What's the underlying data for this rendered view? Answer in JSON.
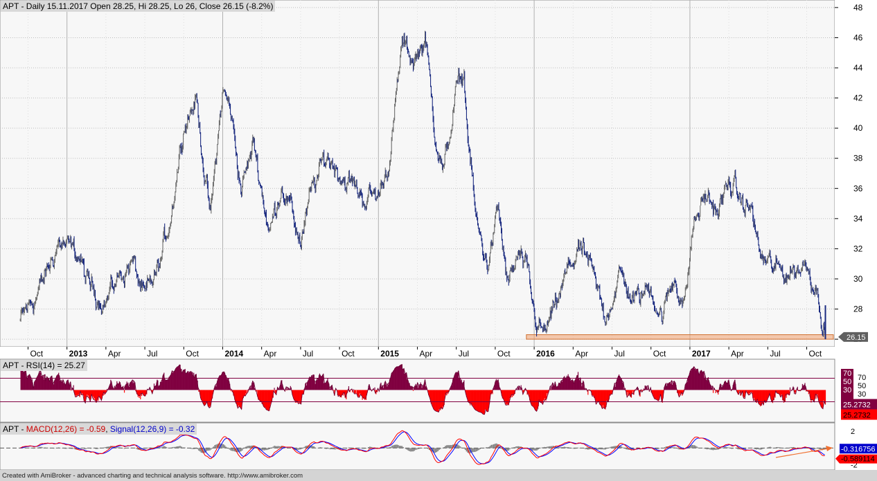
{
  "price_panel": {
    "title": "APT - Daily 15.11.2017 Open 28.25, Hi 28.25, Lo 26, Close 26.15 (-8.2%)",
    "last_close_label": "26.15",
    "highlight_color": "#f0a070"
  },
  "rsi_panel": {
    "title": "APT - RSI(14) = 25.27",
    "value_label": "25.2732",
    "levels": [
      "70",
      "50",
      "30"
    ]
  },
  "macd_panel": {
    "prefix": "APT - ",
    "macd_label": "MACD(12,26) = -0.59",
    "signal_label": "Signal(12,26,9) = -0.32",
    "signal_value_label": "-0.316756",
    "macd_value_label": "-0.589114",
    "ticks": [
      "2",
      "-2"
    ]
  },
  "footer": "Created with AmiBroker - advanced charting and technical analysis software. http://www.amibroker.com",
  "chart_data": [
    {
      "type": "line",
      "title": "APT - Daily 15.11.2017 Open 28.25, Hi 28.25, Lo 26, Close 26.15 (-8.2%)",
      "y_ticks": [
        26,
        28,
        30,
        32,
        34,
        36,
        38,
        40,
        42,
        44,
        46,
        48
      ],
      "ylim": [
        25.5,
        48.5
      ],
      "x_labels": [
        "Oct",
        "2013",
        "Apr",
        "Jul",
        "Oct",
        "2014",
        "Apr",
        "Jul",
        "Oct",
        "2015",
        "Apr",
        "Jul",
        "Oct",
        "2016",
        "Apr",
        "Jul",
        "Oct",
        "2017",
        "Apr",
        "Jul",
        "Oct"
      ],
      "close_anchors": [
        [
          2012.7,
          27.2
        ],
        [
          2012.78,
          28.5
        ],
        [
          2012.87,
          30.3
        ],
        [
          2012.95,
          32.6
        ],
        [
          2013.0,
          32.0
        ],
        [
          2013.08,
          31.5
        ],
        [
          2013.13,
          29.6
        ],
        [
          2013.25,
          28.6
        ],
        [
          2013.33,
          30.1
        ],
        [
          2013.42,
          31.2
        ],
        [
          2013.5,
          28.5
        ],
        [
          2013.6,
          31.0
        ],
        [
          2013.67,
          34.5
        ],
        [
          2013.75,
          40.5
        ],
        [
          2013.83,
          41.9
        ],
        [
          2013.92,
          34.0
        ],
        [
          2014.0,
          42.5
        ],
        [
          2014.05,
          41.2
        ],
        [
          2014.12,
          36.0
        ],
        [
          2014.2,
          39.0
        ],
        [
          2014.3,
          33.0
        ],
        [
          2014.38,
          36.5
        ],
        [
          2014.5,
          32.5
        ],
        [
          2014.58,
          36.0
        ],
        [
          2014.67,
          38.2
        ],
        [
          2014.8,
          36.5
        ],
        [
          2014.9,
          35.5
        ],
        [
          2015.0,
          35.5
        ],
        [
          2015.08,
          38.5
        ],
        [
          2015.15,
          45.5
        ],
        [
          2015.23,
          44.5
        ],
        [
          2015.3,
          46.0
        ],
        [
          2015.36,
          40.0
        ],
        [
          2015.42,
          37.0
        ],
        [
          2015.5,
          42.5
        ],
        [
          2015.55,
          43.5
        ],
        [
          2015.57,
          40.0
        ],
        [
          2015.63,
          33.5
        ],
        [
          2015.7,
          31.0
        ],
        [
          2015.77,
          34.5
        ],
        [
          2015.83,
          29.5
        ],
        [
          2015.9,
          31.5
        ],
        [
          2015.96,
          30.0
        ],
        [
          2016.0,
          27.5
        ],
        [
          2016.06,
          26.3
        ],
        [
          2016.12,
          27.5
        ],
        [
          2016.2,
          30.0
        ],
        [
          2016.28,
          32.0
        ],
        [
          2016.35,
          31.0
        ],
        [
          2016.45,
          27.5
        ],
        [
          2016.55,
          30.2
        ],
        [
          2016.65,
          28.5
        ],
        [
          2016.75,
          29.5
        ],
        [
          2016.82,
          27.5
        ],
        [
          2016.9,
          30.0
        ],
        [
          2016.97,
          28.5
        ],
        [
          2017.02,
          33.5
        ],
        [
          2017.1,
          35.5
        ],
        [
          2017.18,
          34.5
        ],
        [
          2017.26,
          36.5
        ],
        [
          2017.33,
          35.0
        ],
        [
          2017.4,
          34.5
        ],
        [
          2017.45,
          31.5
        ],
        [
          2017.55,
          30.5
        ],
        [
          2017.65,
          30.5
        ],
        [
          2017.75,
          31.0
        ],
        [
          2017.81,
          29.5
        ],
        [
          2017.84,
          28.25
        ],
        [
          2017.87,
          26.15
        ]
      ],
      "last_close": 26.15,
      "support_band": [
        26.0,
        26.3
      ]
    },
    {
      "type": "area",
      "title": "APT - RSI(14) = 25.27",
      "levels": [
        70,
        50,
        30
      ],
      "ylim": [
        0,
        100
      ],
      "last_value": 25.2732,
      "colors": {
        "above_50": "#800040",
        "below_50": "#ff0000",
        "level_lines": "#800040"
      }
    },
    {
      "type": "line",
      "title": "APT - MACD(12,26) = -0.59, Signal(12,26,9) = -0.32",
      "series": [
        {
          "name": "MACD(12,26)",
          "color": "#ff0000",
          "last": -0.589114
        },
        {
          "name": "Signal(12,26,9)",
          "color": "#0000ff",
          "last": -0.316756
        }
      ],
      "y_ticks": [
        2,
        -2
      ],
      "ylim": [
        -2.6,
        3.0
      ]
    }
  ]
}
